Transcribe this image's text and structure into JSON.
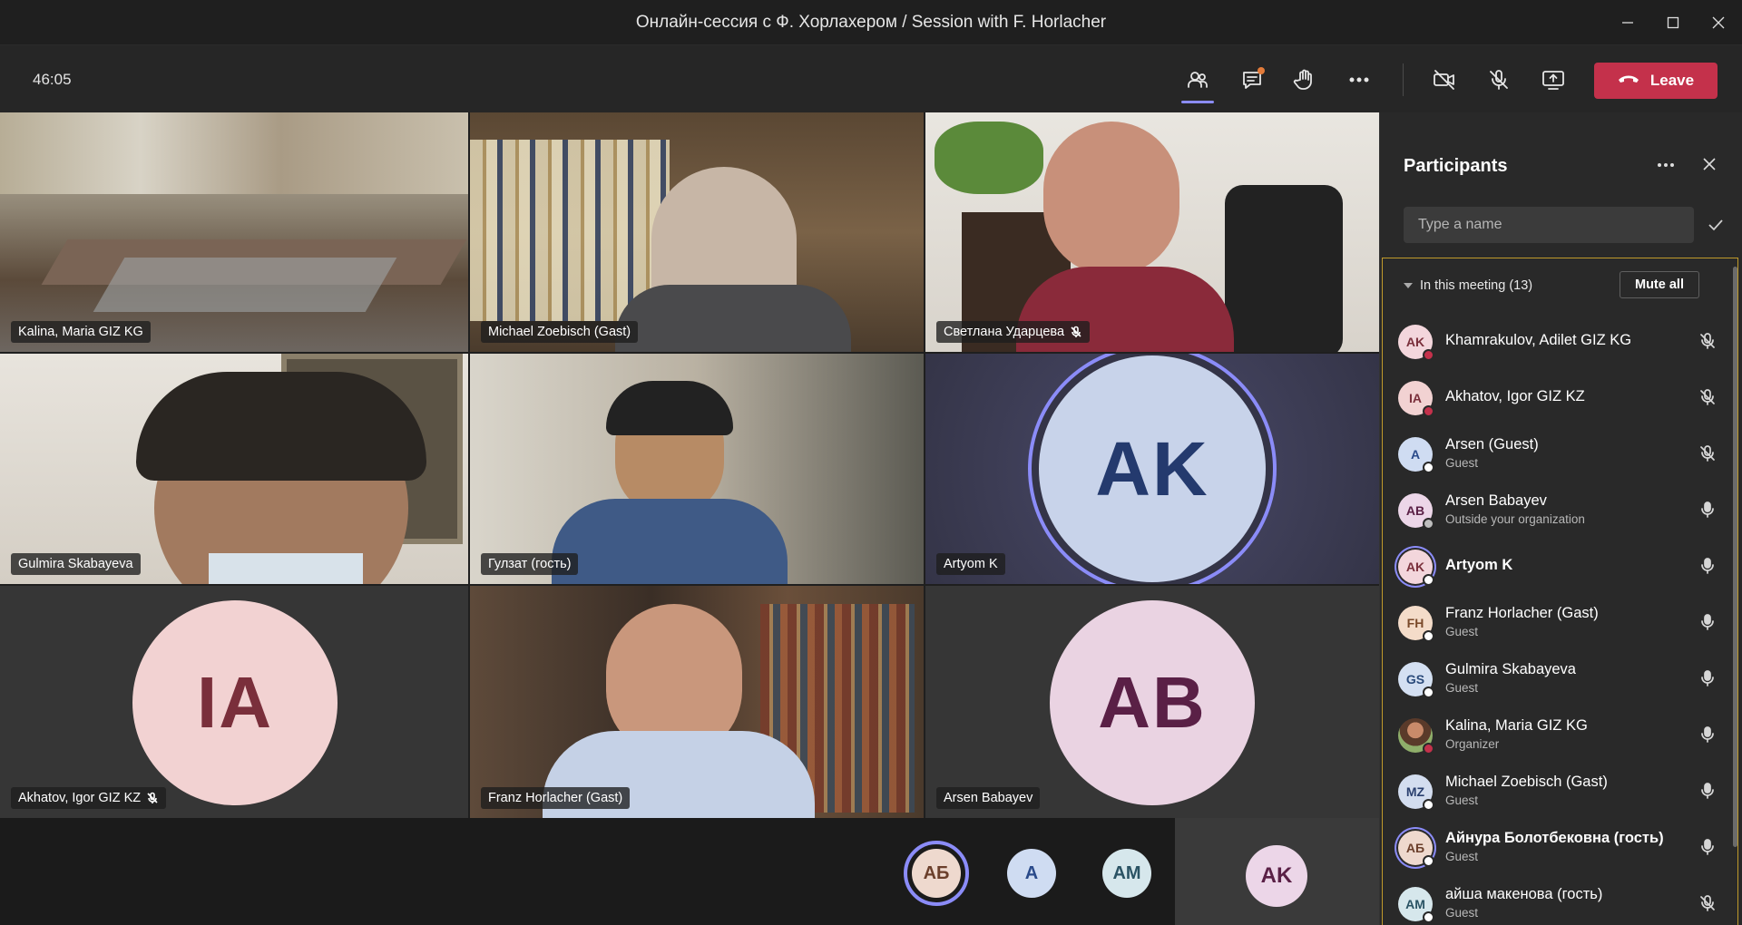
{
  "window": {
    "title": "Онлайн-сессия с Ф. Хорлахером / Session with F. Horlacher"
  },
  "toolbar": {
    "timer": "46:05",
    "leave_label": "Leave",
    "icons": [
      "participants-icon",
      "chat-icon",
      "raise-hand-icon",
      "more-icon",
      "camera-off-icon",
      "mic-off-icon",
      "share-icon"
    ]
  },
  "tiles": [
    {
      "name": "Kalina, Maria GIZ KG",
      "muted": false
    },
    {
      "name": "Michael Zoebisch (Gast)",
      "muted": false
    },
    {
      "name": "Светлана Ударцева",
      "muted": true
    },
    {
      "name": "Gulmira Skabayeva",
      "muted": false
    },
    {
      "name": "Гулзат (гость)",
      "muted": false
    },
    {
      "name": "Artyom K",
      "initials": "AK",
      "muted": false
    },
    {
      "name": "Akhatov, Igor GIZ KZ",
      "initials": "IA",
      "muted": true
    },
    {
      "name": "Franz Horlacher (Gast)",
      "muted": false
    },
    {
      "name": "Arsen Babayev",
      "initials": "AB",
      "muted": false
    }
  ],
  "strip": [
    {
      "initials": "АБ",
      "speaking": true
    },
    {
      "initials": "A",
      "speaking": false
    },
    {
      "initials": "AM",
      "speaking": false
    },
    {
      "initials": "AK",
      "speaking": false
    }
  ],
  "panel": {
    "title": "Participants",
    "search_placeholder": "Type a name",
    "section_label": "In this meeting (13)",
    "mute_all_label": "Mute all",
    "participants": [
      {
        "initials": "AK",
        "name": "Khamrakulov, Adilet GIZ KG",
        "role": "",
        "mic": "off",
        "status": "busy",
        "bold": false
      },
      {
        "initials": "IA",
        "name": "Akhatov, Igor GIZ KZ",
        "role": "",
        "mic": "off",
        "status": "busy",
        "bold": false
      },
      {
        "initials": "A",
        "name": "Arsen (Guest)",
        "role": "Guest",
        "mic": "off",
        "status": "unknown",
        "bold": false
      },
      {
        "initials": "AB",
        "name": "Arsen Babayev",
        "role": "Outside your organization",
        "mic": "on",
        "status": "external",
        "bold": false
      },
      {
        "initials": "AK",
        "name": "Artyom K",
        "role": "",
        "mic": "on",
        "status": "unknown",
        "bold": true
      },
      {
        "initials": "FH",
        "name": "Franz Horlacher (Gast)",
        "role": "Guest",
        "mic": "on",
        "status": "unknown",
        "bold": false
      },
      {
        "initials": "GS",
        "name": "Gulmira Skabayeva",
        "role": "Guest",
        "mic": "on",
        "status": "unknown",
        "bold": false
      },
      {
        "initials": "",
        "name": "Kalina, Maria GIZ KG",
        "role": "Organizer",
        "mic": "on",
        "status": "busy",
        "bold": false
      },
      {
        "initials": "MZ",
        "name": "Michael Zoebisch (Gast)",
        "role": "Guest",
        "mic": "on",
        "status": "unknown",
        "bold": false
      },
      {
        "initials": "АБ",
        "name": "Айнура Болотбековна (гость)",
        "role": "Guest",
        "mic": "on",
        "status": "unknown",
        "bold": true
      },
      {
        "initials": "AM",
        "name": "айша макенова (гость)",
        "role": "Guest",
        "mic": "off",
        "status": "unknown",
        "bold": false
      }
    ]
  },
  "colors": {
    "accent": "#8b8cf8",
    "leave": "#c4314b",
    "busy": "#c4314b"
  }
}
